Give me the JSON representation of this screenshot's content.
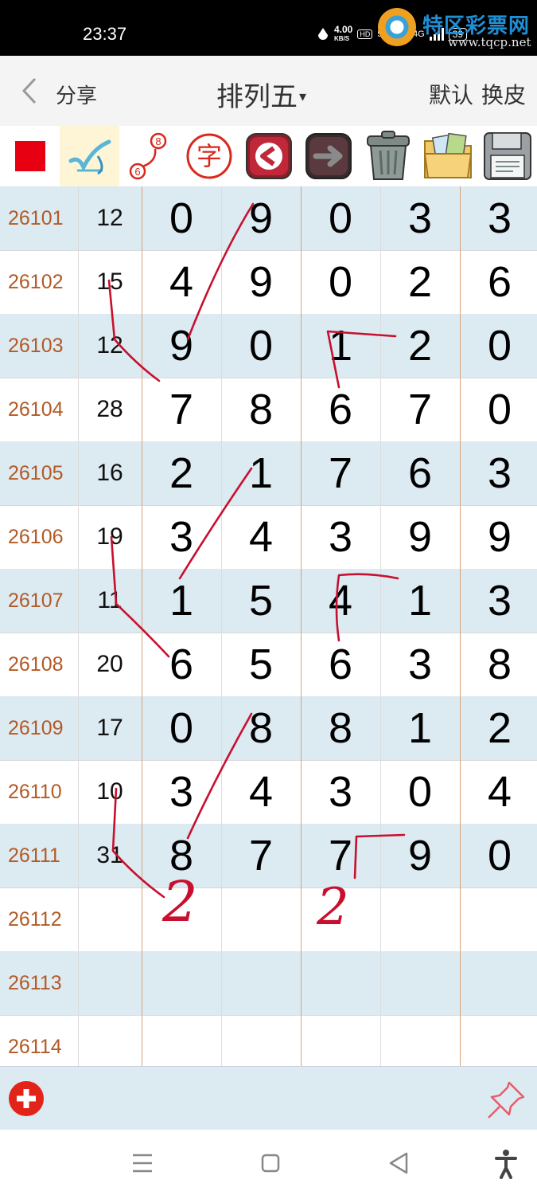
{
  "status_bar": {
    "time": "23:37",
    "net_speed": "4.00",
    "net_speed_unit": "KB/S",
    "hd_label": "HD",
    "net1": "5G",
    "net2": "4G",
    "battery": "39"
  },
  "watermark": {
    "name": "特区彩票网",
    "url": "www.tqcp.net"
  },
  "header": {
    "share_label": "分享",
    "title": "排列五",
    "title_caret": "▾",
    "default_label": "默认",
    "skin_label": "换皮"
  },
  "toolbar": {
    "icons": [
      "red-square-icon",
      "check-draw-icon",
      "number-link-icon",
      "character-icon",
      "back-arrow-icon",
      "forward-arrow-icon",
      "trash-bin-icon",
      "photo-folder-icon",
      "floppy-disk-icon"
    ],
    "link_icon_numbers": [
      "6",
      "8"
    ],
    "character_label": "字",
    "red": "#e60012"
  },
  "table": {
    "rows": [
      {
        "issue": "26101",
        "sum": "12",
        "digits": [
          "0",
          "9",
          "0",
          "3",
          "3"
        ]
      },
      {
        "issue": "26102",
        "sum": "15",
        "digits": [
          "4",
          "9",
          "0",
          "2",
          "6"
        ]
      },
      {
        "issue": "26103",
        "sum": "12",
        "digits": [
          "9",
          "0",
          "1",
          "2",
          "0"
        ]
      },
      {
        "issue": "26104",
        "sum": "28",
        "digits": [
          "7",
          "8",
          "6",
          "7",
          "0"
        ]
      },
      {
        "issue": "26105",
        "sum": "16",
        "digits": [
          "2",
          "1",
          "7",
          "6",
          "3"
        ]
      },
      {
        "issue": "26106",
        "sum": "19",
        "digits": [
          "3",
          "4",
          "3",
          "9",
          "9"
        ]
      },
      {
        "issue": "26107",
        "sum": "11",
        "digits": [
          "1",
          "5",
          "4",
          "1",
          "3"
        ]
      },
      {
        "issue": "26108",
        "sum": "20",
        "digits": [
          "6",
          "5",
          "6",
          "3",
          "8"
        ]
      },
      {
        "issue": "26109",
        "sum": "17",
        "digits": [
          "0",
          "8",
          "8",
          "1",
          "2"
        ]
      },
      {
        "issue": "26110",
        "sum": "10",
        "digits": [
          "3",
          "4",
          "3",
          "0",
          "4"
        ]
      },
      {
        "issue": "26111",
        "sum": "31",
        "digits": [
          "8",
          "7",
          "7",
          "9",
          "0"
        ]
      },
      {
        "issue": "26112",
        "sum": "",
        "digits": [
          "",
          "",
          "",
          "",
          ""
        ]
      },
      {
        "issue": "26113",
        "sum": "",
        "digits": [
          "",
          "",
          "",
          "",
          ""
        ]
      },
      {
        "issue": "26114",
        "sum": "",
        "digits": [
          "",
          "",
          "",
          "",
          ""
        ]
      }
    ],
    "handwritten_marks": [
      "2",
      "2"
    ],
    "colors": {
      "issue_text": "#b35a25",
      "row_alt": "#dceaf2",
      "ink": "#c8102e"
    }
  },
  "navbar": {
    "icons": [
      "menu-icon",
      "home-icon",
      "back-icon",
      "accessibility-icon"
    ]
  }
}
